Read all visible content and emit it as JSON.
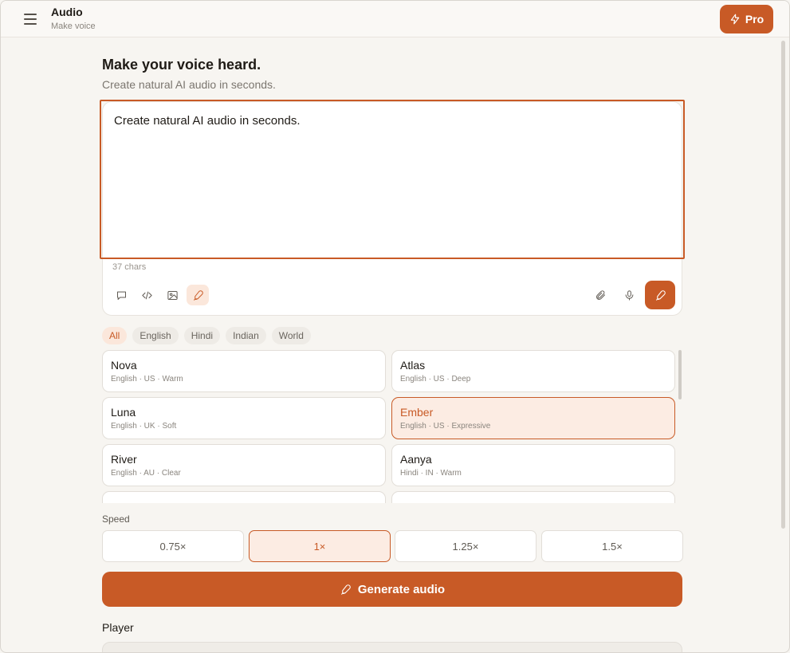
{
  "header": {
    "title": "Audio",
    "subtitle": "Make voice",
    "pro_label": "Pro"
  },
  "hero": {
    "title": "Make your voice heard.",
    "subtitle": "Create natural AI audio in seconds."
  },
  "composer": {
    "text_value": "Create natural AI audio in seconds.",
    "char_count": "37 chars",
    "tools": [
      "chat-icon",
      "code-icon",
      "image-icon",
      "voice-pen-icon"
    ],
    "active_tool": "voice-pen-icon",
    "right_tools": [
      "paperclip-icon",
      "microphone-icon"
    ]
  },
  "filters": [
    {
      "label": "All",
      "active": true
    },
    {
      "label": "English",
      "active": false
    },
    {
      "label": "Hindi",
      "active": false
    },
    {
      "label": "Indian",
      "active": false
    },
    {
      "label": "World",
      "active": false
    }
  ],
  "voices": [
    {
      "name": "Nova",
      "meta": "English · US · Warm",
      "selected": false
    },
    {
      "name": "Atlas",
      "meta": "English · US · Deep",
      "selected": false
    },
    {
      "name": "Luna",
      "meta": "English · UK · Soft",
      "selected": false
    },
    {
      "name": "Ember",
      "meta": "English · US · Expressive",
      "selected": true
    },
    {
      "name": "River",
      "meta": "English · AU · Clear",
      "selected": false
    },
    {
      "name": "Aanya",
      "meta": "Hindi · IN · Warm",
      "selected": false
    }
  ],
  "speed": {
    "label": "Speed",
    "options": [
      "0.75×",
      "1×",
      "1.25×",
      "1.5×"
    ],
    "selected": "1×"
  },
  "generate_label": "Generate audio",
  "player_label": "Player",
  "colors": {
    "accent": "#c85a26",
    "accent_soft": "#fcece3",
    "background": "#f7f5f1"
  }
}
